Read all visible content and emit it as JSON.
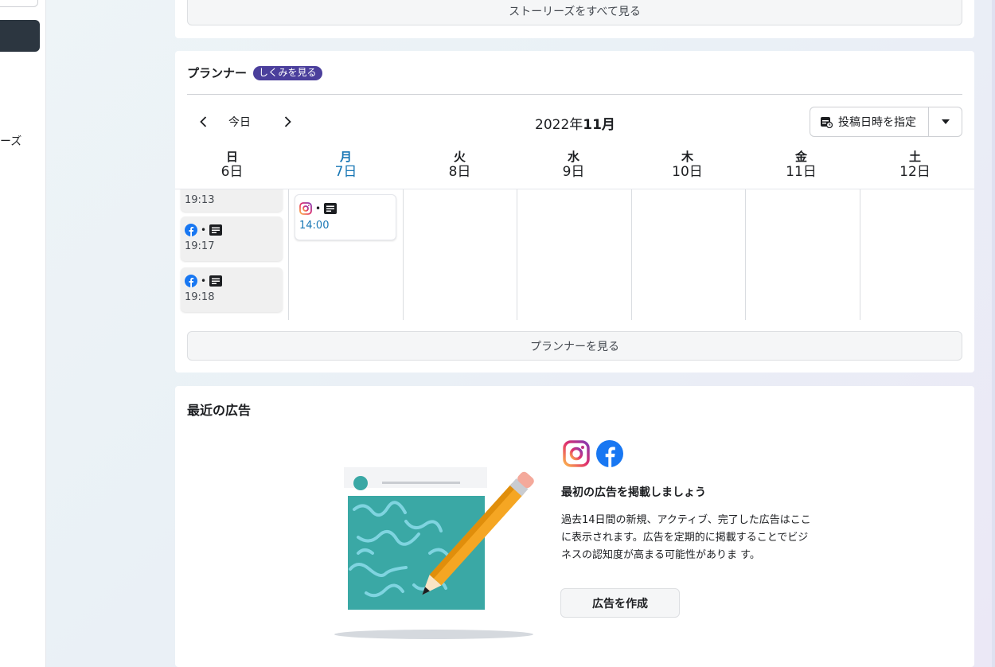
{
  "sidebar": {
    "partial_label": "ーズ"
  },
  "stories": {
    "see_all_label": "ストーリーズをすべて見る"
  },
  "planner": {
    "title": "プランナー",
    "badge": "しくみを見る",
    "today_label": "今日",
    "month_year": "2022年",
    "month": "11月",
    "schedule_button": "投稿日時を指定",
    "days": [
      {
        "dow": "日",
        "date": "6日",
        "today": false
      },
      {
        "dow": "月",
        "date": "7日",
        "today": true
      },
      {
        "dow": "火",
        "date": "8日",
        "today": false
      },
      {
        "dow": "水",
        "date": "9日",
        "today": false
      },
      {
        "dow": "木",
        "date": "10日",
        "today": false
      },
      {
        "dow": "金",
        "date": "11日",
        "today": false
      },
      {
        "dow": "土",
        "date": "12日",
        "today": false
      }
    ],
    "posts": [
      {
        "day": "日",
        "platform": "facebook",
        "type": "post",
        "time": "19:13"
      },
      {
        "day": "日",
        "platform": "facebook",
        "type": "post",
        "time": "19:17"
      },
      {
        "day": "日",
        "platform": "facebook",
        "type": "post",
        "time": "19:18"
      },
      {
        "day": "月",
        "platform": "instagram",
        "type": "post",
        "time": "14:00"
      }
    ],
    "see_planner_label": "プランナーを見る"
  },
  "ads": {
    "title": "最近の広告",
    "heading": "最初の広告を掲載しましょう",
    "description": "過去14日間の新規、アクティブ、完了した広告はここに表示されます。広告を定期的に掲載することでビジネスの認知度が高まる可能性がありま す。",
    "create_button": "広告を作成",
    "logos": [
      "instagram-icon",
      "facebook-icon"
    ]
  },
  "colors": {
    "today_blue": "#1877b5",
    "badge_purple": "#4b3f9c",
    "facebook_blue": "#1877f2",
    "sidebar_active": "#2c3640"
  }
}
